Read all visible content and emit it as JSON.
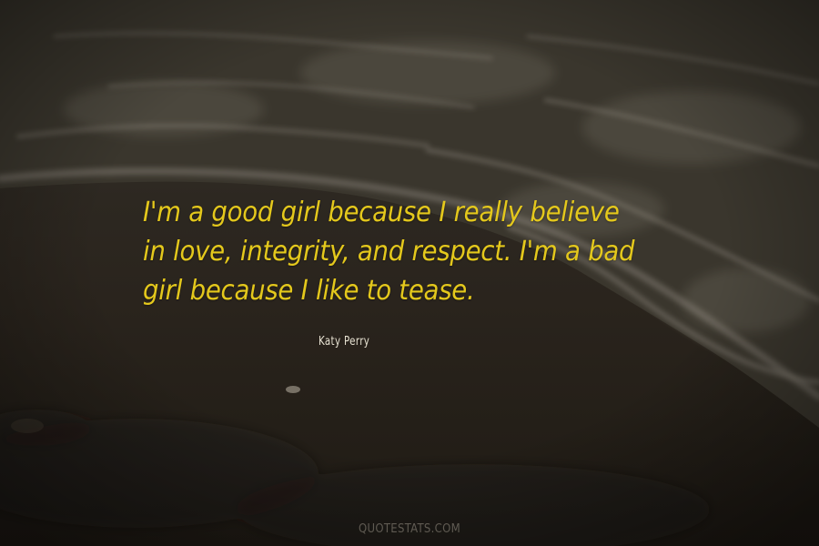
{
  "quote": {
    "text": "I'm a good girl because I really believe in love, integrity, and respect. I'm a bad girl because I like to tease.",
    "author": "Katy Perry"
  },
  "watermark": "QUOTESTATS.COM",
  "colors": {
    "quote_text": "#e4c81c",
    "author_text": "#e7e2d2",
    "sand": "#2a241c",
    "water": "#3b372e",
    "foam": "#8c877b"
  }
}
